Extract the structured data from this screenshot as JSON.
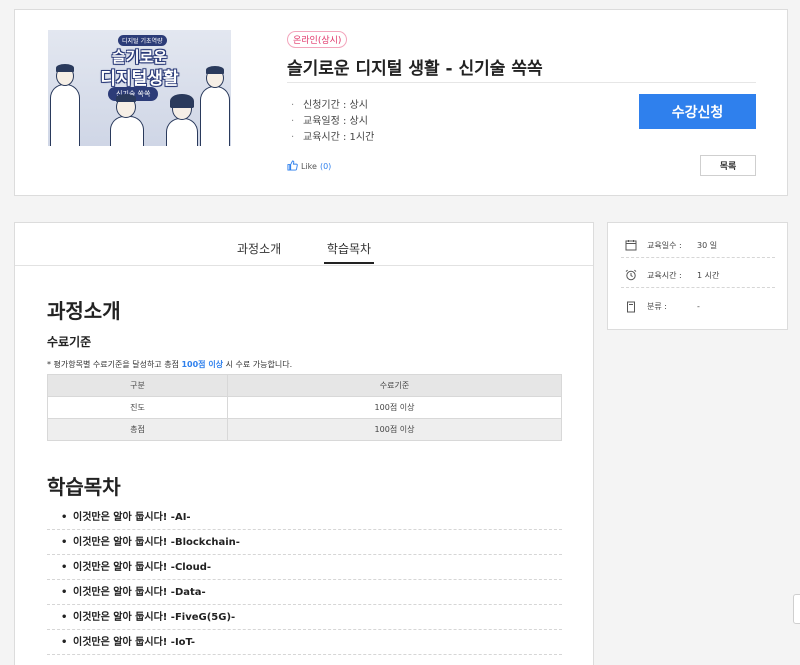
{
  "course": {
    "thumb_badge": "디지털 기초역량",
    "thumb_line1": "슬기로운",
    "thumb_line2": "디지털생활",
    "thumb_sub": "신기술 쏙쏙",
    "tag": "온라인(상시)",
    "title": "슬기로운 디지털 생활 - 신기술 쏙쏙",
    "info": [
      "신청기간 : 상시",
      "교육일정 : 상시",
      "교육시간 : 1시간"
    ],
    "apply_label": "수강신청",
    "like_label": "Like",
    "like_count": "(0)",
    "list_label": "목록"
  },
  "tabs": [
    "과정소개",
    "학습목차"
  ],
  "intro": {
    "heading": "과정소개",
    "criteria_heading": "수료기준",
    "note_prefix": "* 평가항목별 수료기준을 달성하고 총점 ",
    "note_highlight": "100점 이상",
    "note_suffix": " 시 수료 가능합니다.",
    "table": {
      "headers": [
        "구분",
        "수료기준"
      ],
      "rows": [
        [
          "진도",
          "100점 이상"
        ],
        [
          "총점",
          "100점 이상"
        ]
      ]
    }
  },
  "toc": {
    "heading": "학습목차",
    "items": [
      "이것만은 알아 둡시다! -AI-",
      "이것만은 알아 둡시다! -Blockchain-",
      "이것만은 알아 둡시다! -Cloud-",
      "이것만은 알아 둡시다! -Data-",
      "이것만은 알아 둡시다! -FiveG(5G)-",
      "이것만은 알아 둡시다! -IoT-"
    ]
  },
  "sidebar": {
    "rows": [
      {
        "icon": "calendar-icon",
        "label": "교육일수 :",
        "value": "30 일"
      },
      {
        "icon": "alarm-clock-icon",
        "label": "교육시간 :",
        "value": "1 시간"
      },
      {
        "icon": "document-icon",
        "label": "분류 :",
        "value": "-"
      }
    ]
  }
}
